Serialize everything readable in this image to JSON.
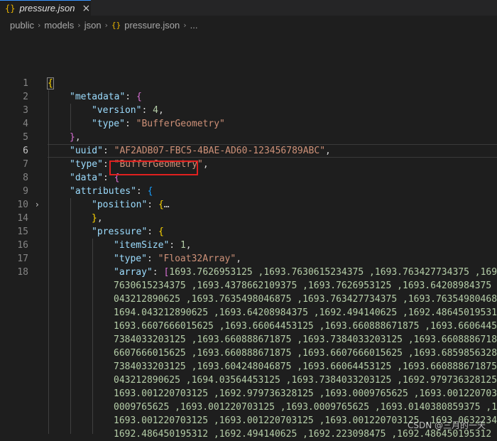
{
  "tab": {
    "icon": "{}",
    "title": "pressure.json",
    "close": "×"
  },
  "breadcrumb": [
    "public",
    "models",
    "json",
    "pressure.json",
    "..."
  ],
  "breadcrumb_file_icon": "{}",
  "line_numbers": [
    "1",
    "2",
    "3",
    "4",
    "5",
    "6",
    "7",
    "8",
    "9",
    "10",
    "14",
    "15",
    "16",
    "17",
    "18"
  ],
  "active_line": "6",
  "fold_icon": "›",
  "json": {
    "k_metadata": "\"metadata\"",
    "k_version": "\"version\"",
    "v_version": "4",
    "k_type": "\"type\"",
    "v_type_meta": "\"BufferGeometry\"",
    "k_uuid": "\"uuid\"",
    "v_uuid": "\"AF2ADB07-FBC5-4BAE-AD60-123456789ABC\"",
    "v_type": "\"BufferGeometry\"",
    "k_data": "\"data\"",
    "k_attributes": "\"attributes\"",
    "k_position": "\"position\"",
    "collapsed": "…",
    "k_pressure": "\"pressure\"",
    "k_itemSize": "\"itemSize\"",
    "v_itemSize": "1",
    "v_type_array": "\"Float32Array\"",
    "k_array": "\"array\"",
    "array_lines": [
      "1693.7626953125 ,1693.7630615234375 ,1693.763427734375 ,1693",
      "7630615234375 ,1693.4378662109375 ,1693.7626953125 ,1693.64208984375 ,1",
      "043212890625 ,1693.7635498046875 ,1693.763427734375 ,1693.7635498046875",
      "1694.043212890625 ,1693.64208984375 ,1692.494140625 ,1692.486450195312",
      "1693.6607666015625 ,1693.66064453125 ,1693.660888671875 ,1693.66064453",
      "7384033203125 ,1693.660888671875 ,1693.7384033203125 ,1693.660888671875",
      "6607666015625 ,1693.660888671875 ,1693.6607666015625 ,1693.685985632812",
      "7384033203125 ,1693.604248046875 ,1693.66064453125 ,1693.660888671875",
      "043212890625 ,1694.03564453125 ,1693.7384033203125 ,1692.979736328125",
      "1693.001220703125 ,1692.979736328125 ,1693.0009765625 ,1693.0012207031",
      "0009765625 ,1693.001220703125 ,1693.0009765625 ,1693.0140380859375 ,169",
      "1693.001220703125 ,1693.001220703125 ,1693.001220703125 ,1693.063223421",
      "1692.486450195312 ,1692.494140625 ,1692.223098475 ,1692.486450195312"
    ]
  },
  "watermark": "CSDN @三月的一天",
  "colors": {
    "key": "#9cdcfe",
    "string": "#ce9178",
    "number": "#b5cea8",
    "bracket_gold": "#ffd700",
    "bracket_orchid": "#da70d6",
    "bracket_blue": "#179fff",
    "highlight_box": "#e0201f"
  }
}
